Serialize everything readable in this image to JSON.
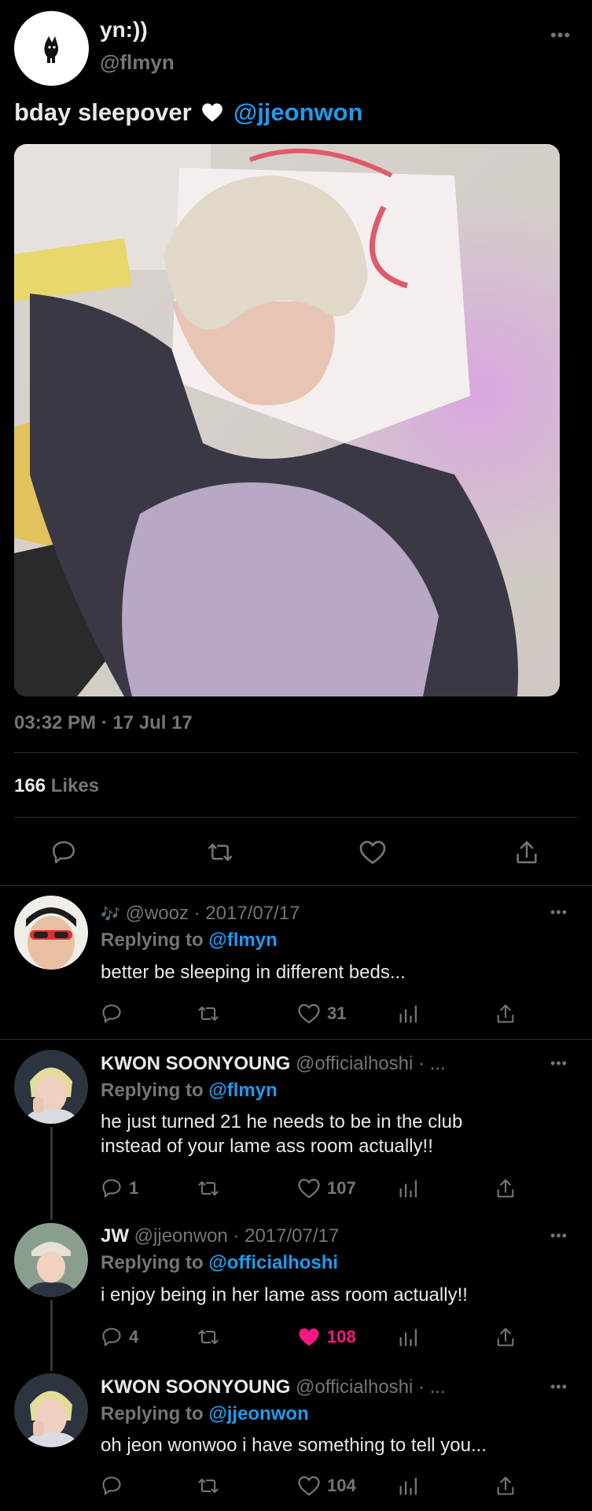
{
  "tweet": {
    "display_name": "yn:))",
    "handle": "@flmyn",
    "text_prefix": "bday sleepover",
    "mention": "@jjeonwon",
    "timestamp": "03:32 PM · 17 Jul 17",
    "likes_count": "166",
    "likes_label": "Likes",
    "image_alt": "photo of a person with light blonde hair asleep on a white pillow under a lilac blanket"
  },
  "replies": [
    {
      "name": "",
      "note_glyph": "🎶",
      "handle_date": "@wooz · 2017/07/17",
      "replying_label": "Replying to",
      "replying_to": "@flmyn",
      "text": "better be sleeping in different beds...",
      "reply_count": "",
      "like_count": "31",
      "liked": false
    },
    {
      "name": "KWON SOONYOUNG",
      "handle_date": "@officialhoshi · ...",
      "replying_label": "Replying to",
      "replying_to": "@flmyn",
      "text_line1": "he just turned 21 he needs to be in the club",
      "text_line2": "instead of your lame ass room actually!!",
      "reply_count": "1",
      "like_count": "107",
      "liked": false
    },
    {
      "name": "JW",
      "handle_date": "@jjeonwon · 2017/07/17",
      "replying_label": "Replying to",
      "replying_to": "@officialhoshi",
      "text": "i enjoy being in her lame ass room actually!!",
      "reply_count": "4",
      "like_count": "108",
      "liked": true
    },
    {
      "name": "KWON SOONYOUNG",
      "handle_date": "@officialhoshi · ...",
      "replying_label": "Replying to",
      "replying_to": "@jjeonwon",
      "text": "oh jeon wonwoo i have something to tell you...",
      "reply_count": "",
      "like_count": "104",
      "liked": false
    }
  ],
  "colors": {
    "background": "#000000",
    "text": "#e7e9ea",
    "muted": "#71767b",
    "link": "#1d9bf0",
    "like_active": "#f91880",
    "divider": "#2f3336"
  },
  "icons": [
    "more-icon",
    "reply-icon",
    "retweet-icon",
    "like-icon",
    "share-icon",
    "analytics-icon",
    "cat-logo-icon"
  ]
}
